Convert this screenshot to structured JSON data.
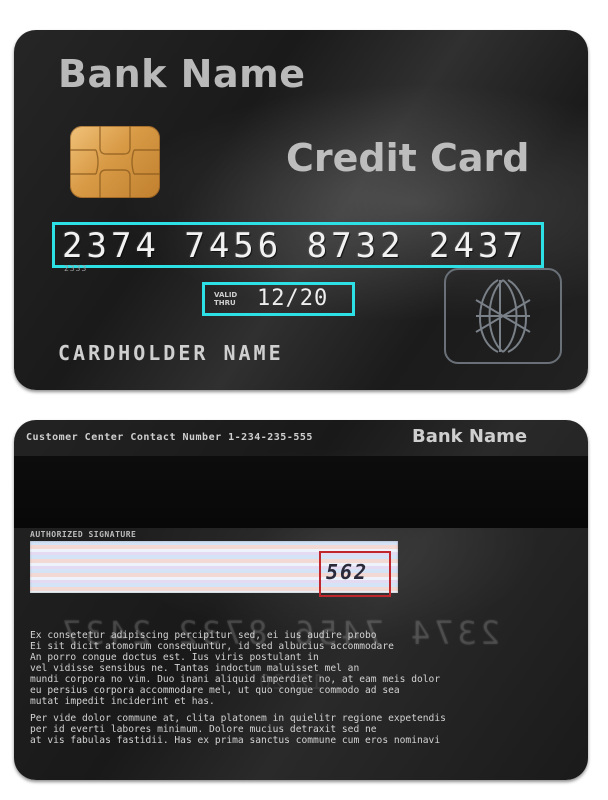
{
  "front": {
    "bank_name": "Bank Name",
    "card_type": "Credit Card",
    "card_number": "2374 7456 8732 2437",
    "card_number_small": "2333",
    "valid_label_line1": "VALID",
    "valid_label_line2": "THRU",
    "valid_date": "12/20",
    "cardholder_name": "CARDHOLDER NAME",
    "highlight_color": "#2ce0e6"
  },
  "back": {
    "contact_text": "Customer Center Contact Number 1-234-235-555",
    "bank_name": "Bank Name",
    "signature_label": "AUTHORIZED SIGNATURE",
    "cvv": "562",
    "cvv_highlight_color": "#c0272d",
    "terms_paragraph_1": "Ex consetetur adipiscing percipitur sed, ei ius audire probo\nEi sit dicit atomorum consequuntur, id sed albucius accommodare\nAn porro congue doctus est. Ius viris postulant in\nvel vidisse sensibus ne. Tantas indoctum maluisset mel an\nmundi corpora no vim. Duo inani aliquid imperdiet no, at eam meis dolor\neu persius corpora accommodare mel, ut quo congue commodo ad sea\nmutat impedit inciderint et has.",
    "terms_paragraph_2": "Per vide dolor commune at, clita platonem in quielitr regione expetendis\nper id everti labores minimum. Dolore mucius detraxit sed ne\nat vis fabulas fastidii. Has ex prima sanctus commune cum eros nominavi"
  }
}
